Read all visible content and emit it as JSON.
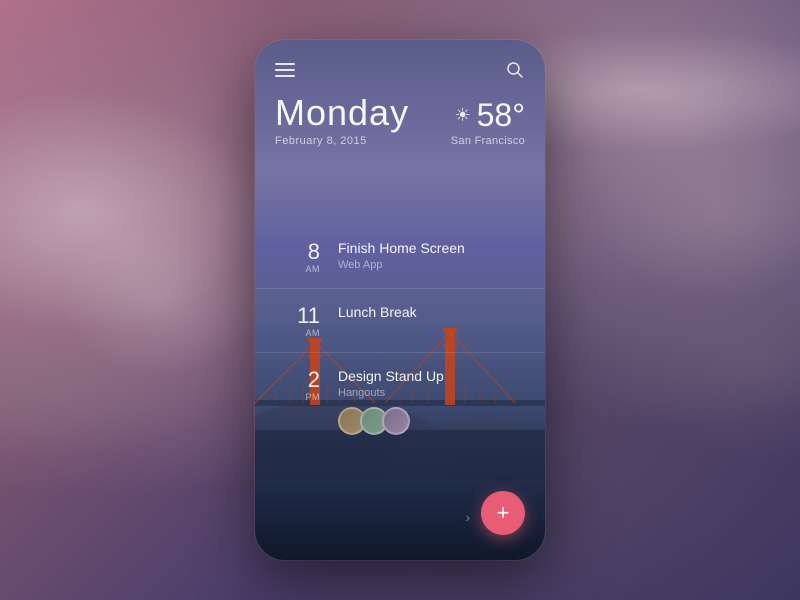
{
  "background": {
    "color": "#6b4a5e"
  },
  "phone": {
    "header": {
      "menu_icon": "hamburger-menu",
      "search_icon": "search"
    },
    "date": {
      "day": "Monday",
      "full_date": "February 8, 2015"
    },
    "weather": {
      "temperature": "58°",
      "location": "San Francisco",
      "icon": "sun-icon"
    },
    "events": [
      {
        "hour": "8",
        "ampm": "AM",
        "title": "Finish Home Screen",
        "subtitle": "Web App",
        "avatars": []
      },
      {
        "hour": "11",
        "ampm": "AM",
        "title": "Lunch Break",
        "subtitle": "",
        "avatars": []
      },
      {
        "hour": "2",
        "ampm": "PM",
        "title": "Design Stand Up",
        "subtitle": "Hangouts",
        "avatars": [
          "A",
          "B",
          "C"
        ]
      }
    ],
    "fab": {
      "label": "+"
    }
  }
}
